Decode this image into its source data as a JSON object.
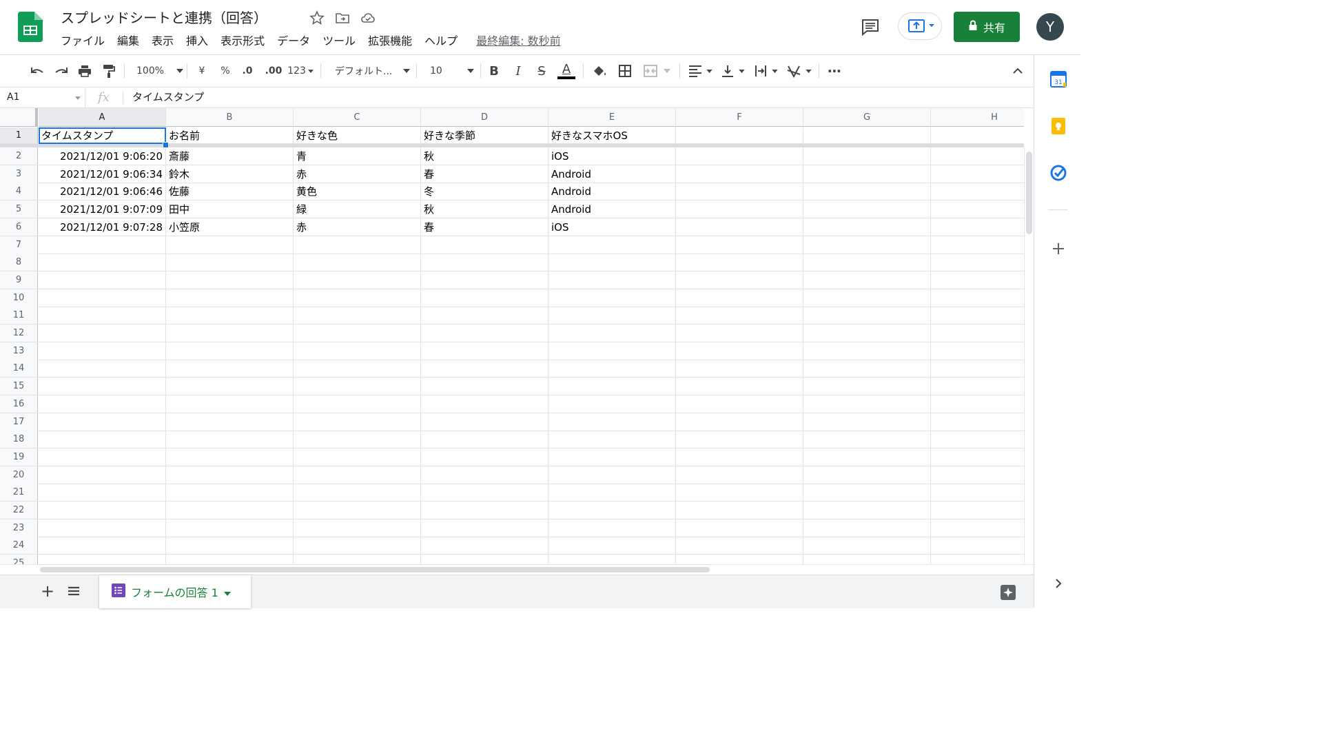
{
  "header": {
    "title": "スプレッドシートと連携（回答）",
    "menus": [
      "ファイル",
      "編集",
      "表示",
      "挿入",
      "表示形式",
      "データ",
      "ツール",
      "拡張機能",
      "ヘルプ"
    ],
    "last_edit": "最終編集: 数秒前",
    "share_label": "共有",
    "avatar_letter": "Y"
  },
  "toolbar": {
    "zoom": "100%",
    "currency": "¥",
    "percent": "%",
    "decimal_less": ".0",
    "decimal_more": ".00",
    "more_formats": "123",
    "font": "デフォルト...",
    "font_size": "10",
    "bold": "B",
    "italic": "I",
    "strike": "S",
    "text_color": "A",
    "more": "⋯"
  },
  "formula_bar": {
    "cell_ref": "A1",
    "fx": "fx",
    "content": "タイムスタンプ"
  },
  "grid": {
    "columns": [
      "A",
      "B",
      "C",
      "D",
      "E",
      "F",
      "G",
      "H"
    ],
    "row_numbers": [
      "1",
      "2",
      "3",
      "4",
      "5",
      "6",
      "7",
      "8",
      "9",
      "10",
      "11",
      "12",
      "13",
      "14",
      "15",
      "16",
      "17",
      "18",
      "19",
      "20",
      "21",
      "22",
      "23",
      "24",
      "25"
    ],
    "headers": [
      "タイムスタンプ",
      "お名前",
      "好きな色",
      "好きな季節",
      "好きなスマホOS"
    ],
    "rows": [
      [
        "2021/12/01 9:06:20",
        "斎藤",
        "青",
        "秋",
        "iOS"
      ],
      [
        "2021/12/01 9:06:34",
        "鈴木",
        "赤",
        "春",
        "Android"
      ],
      [
        "2021/12/01 9:06:46",
        "佐藤",
        "黄色",
        "冬",
        "Android"
      ],
      [
        "2021/12/01 9:07:09",
        "田中",
        "緑",
        "秋",
        "Android"
      ],
      [
        "2021/12/01 9:07:28",
        "小笠原",
        "赤",
        "春",
        "iOS"
      ]
    ]
  },
  "sheet_tab": {
    "label": "フォームの回答 1"
  },
  "colors": {
    "accent": "#1a73e8",
    "share_green": "#188038",
    "sheets_green": "#0f9d58",
    "forms_purple": "#7248b9"
  }
}
